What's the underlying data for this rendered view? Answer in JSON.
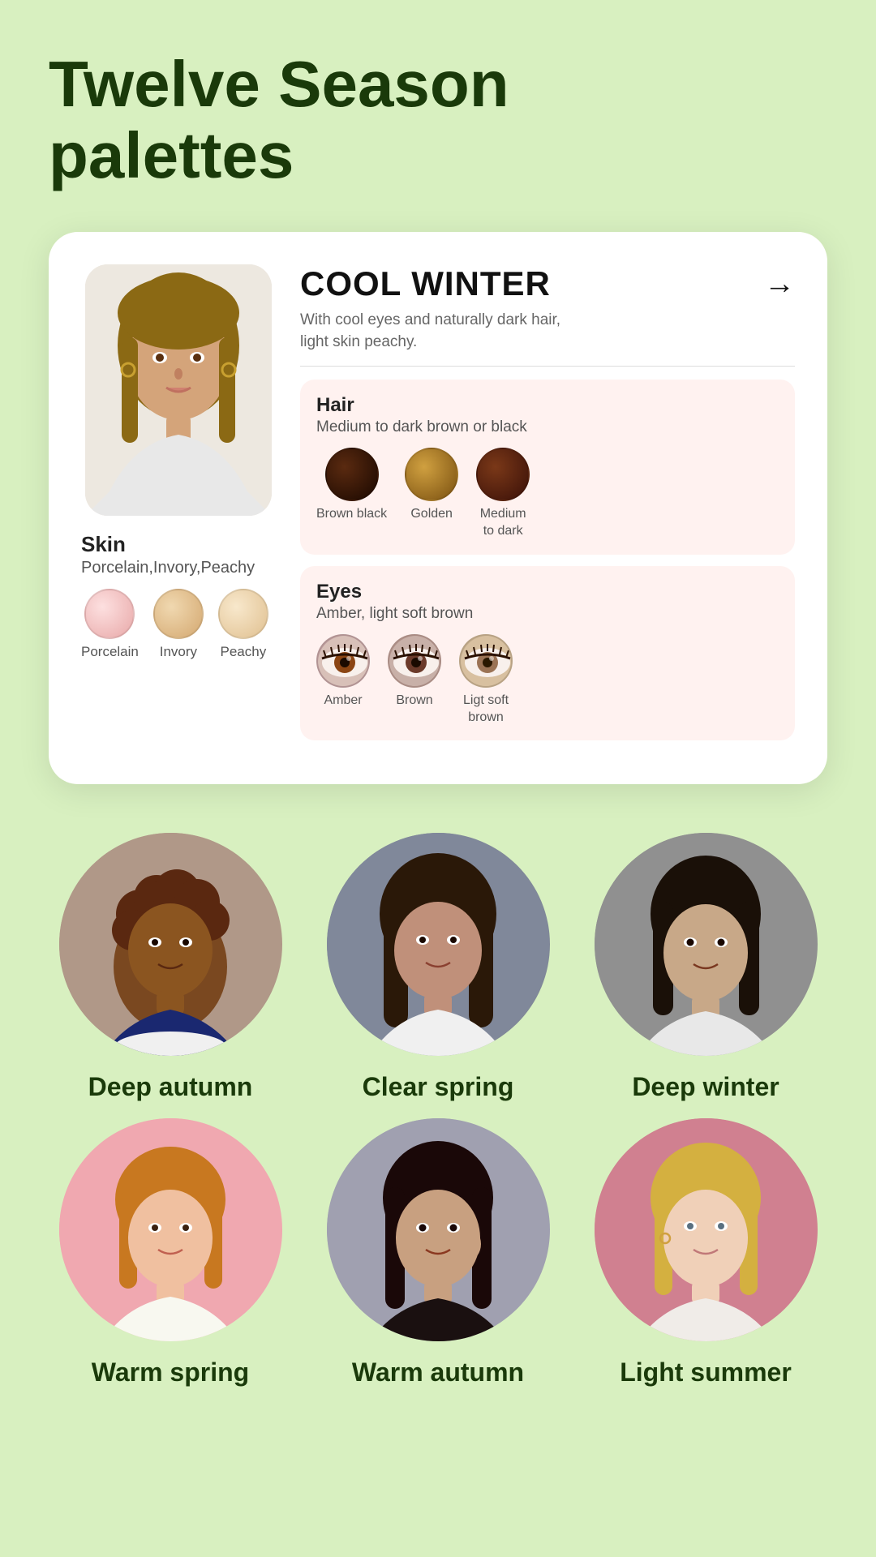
{
  "page": {
    "title": "Twelve Season\npalettes",
    "background": "#d8f0c0"
  },
  "main_card": {
    "season_title": "COOL WINTER",
    "season_desc": "With cool eyes and naturally dark hair,\nlight skin peachy.",
    "arrow": "→",
    "skin": {
      "title": "Skin",
      "subtitle": "Porcelain,Invory,Peachy",
      "swatches": [
        {
          "name": "Porcelain",
          "color": "#f5c6c6"
        },
        {
          "name": "Invory",
          "color": "#e8c99a"
        },
        {
          "name": "Peachy",
          "color": "#f0d9bb"
        }
      ]
    },
    "hair": {
      "title": "Hair",
      "subtitle": "Medium to dark brown or black",
      "swatches": [
        {
          "name": "Brown black",
          "color": "#3a1a0a"
        },
        {
          "name": "Golden",
          "color": "#b8882a"
        },
        {
          "name": "Medium\nto dark",
          "color": "#5c2a10"
        }
      ]
    },
    "eyes": {
      "title": "Eyes",
      "subtitle": "Amber, light soft brown",
      "swatches": [
        {
          "name": "Amber",
          "color": "#8B4513"
        },
        {
          "name": "Brown",
          "color": "#6B3A2A"
        },
        {
          "name": "Ligt soft\nbrown",
          "color": "#9B7355"
        }
      ]
    }
  },
  "seasons": [
    {
      "name": "Deep autumn",
      "bg": "#c0b0a0"
    },
    {
      "name": "Clear spring",
      "bg": "#a0a8b0"
    },
    {
      "name": "Deep winter",
      "bg": "#909090"
    },
    {
      "name": "Warm spring",
      "bg": "#f0a8b0"
    },
    {
      "name": "Warm autumn",
      "bg": "#a0a0a8"
    },
    {
      "name": "Light summer",
      "bg": "#d08090"
    }
  ]
}
